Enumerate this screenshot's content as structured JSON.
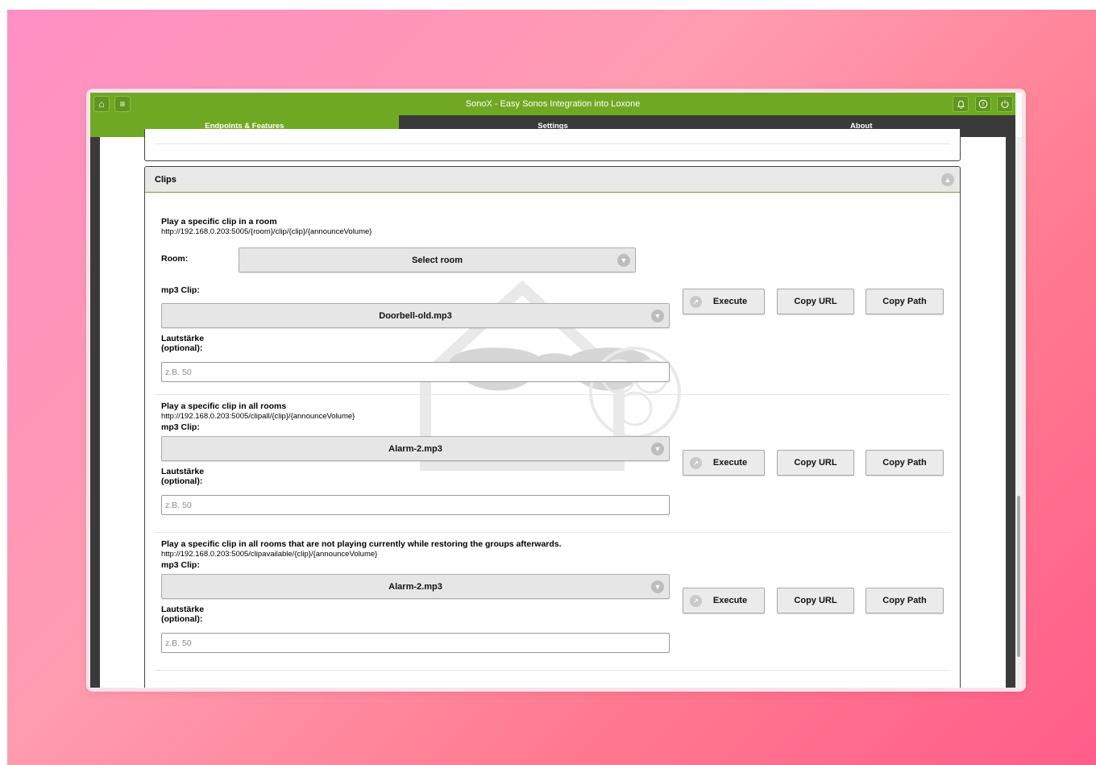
{
  "app": {
    "title": "SonoX - Easy Sonos Integration into Loxone",
    "icons": {
      "home": "home-icon",
      "menu": "menu-icon",
      "bell": "bell-icon",
      "help": "help-icon",
      "power": "power-icon"
    }
  },
  "tabs": [
    {
      "label": "Endpoints & Features",
      "active": true
    },
    {
      "label": "Settings",
      "active": false
    },
    {
      "label": "About",
      "active": false
    }
  ],
  "colors": {
    "accent": "#6fa923",
    "dark": "#3a3a3a"
  },
  "panel": {
    "title": "Clips",
    "sections": [
      {
        "title": "Play a specific clip in a room",
        "url": "http://192.168.0.203:5005/{room}/clip/{clip}/{announceVolume}",
        "room_label": "Room:",
        "room_value": "Select room",
        "clip_label": "mp3 Clip:",
        "clip_value": "Doorbell-old.mp3",
        "volume_label_1": "Lautstärke",
        "volume_label_2": "(optional):",
        "volume_placeholder": "z.B. 50",
        "execute": "Execute",
        "copy_url": "Copy URL",
        "copy_path": "Copy Path"
      },
      {
        "title": "Play a specific clip in all rooms",
        "url": "http://192.168.0.203:5005/clipall/{clip}/{announceVolume}",
        "clip_label": "mp3 Clip:",
        "clip_value": "Alarm-2.mp3",
        "volume_label_1": "Lautstärke",
        "volume_label_2": "(optional):",
        "volume_placeholder": "z.B. 50",
        "execute": "Execute",
        "copy_url": "Copy URL",
        "copy_path": "Copy Path"
      },
      {
        "title": "Play a specific clip in all rooms that are not playing currently while restoring the groups afterwards.",
        "url": "http://192.168.0.203:5005/clipavailable/{clip}/{announceVolume}",
        "clip_label": "mp3 Clip:",
        "clip_value": "Alarm-2.mp3",
        "volume_label_1": "Lautstärke",
        "volume_label_2": "(optional):",
        "volume_placeholder": "z.B. 50",
        "execute": "Execute",
        "copy_url": "Copy URL",
        "copy_path": "Copy Path"
      }
    ]
  }
}
